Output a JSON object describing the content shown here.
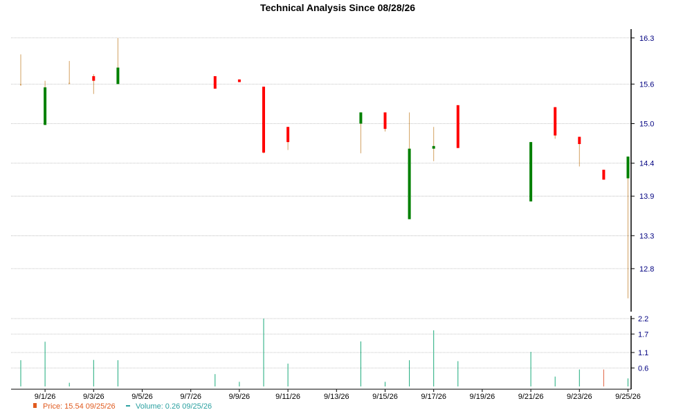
{
  "chart_data": {
    "type": "candlestick",
    "title": "Technical Analysis Since 08/28/26",
    "price_axis": {
      "ylim": [
        12.2,
        16.35
      ],
      "ticks": [
        16.3,
        15.6,
        15.0,
        14.4,
        13.9,
        13.3,
        12.8
      ],
      "tick_labels": [
        "16.3",
        "15.6",
        "15.0",
        "14.4",
        "13.9",
        "13.3",
        "12.8"
      ]
    },
    "volume_axis": {
      "ylim": [
        0.0,
        2.2
      ],
      "ticks": [
        2.2,
        1.7,
        1.1,
        0.6
      ],
      "tick_labels": [
        "2.2",
        "1.7",
        "1.1",
        "0.6"
      ]
    },
    "x_axis": {
      "date_labels": [
        "9/1/26",
        "9/3/26",
        "9/5/26",
        "9/7/26",
        "9/9/26",
        "9/11/26",
        "9/13/26",
        "9/15/26",
        "9/17/26",
        "9/19/26",
        "9/21/26",
        "9/23/26",
        "9/25/26"
      ]
    },
    "candles": [
      {
        "date": "8/31/26",
        "open": 15.6,
        "high": 16.05,
        "low": 15.6,
        "close": 15.6,
        "dir": "flat"
      },
      {
        "date": "9/1/26",
        "open": 14.98,
        "high": 15.65,
        "low": 14.98,
        "close": 15.55,
        "dir": "up"
      },
      {
        "date": "9/2/26",
        "open": 15.62,
        "high": 15.95,
        "low": 15.6,
        "close": 15.62,
        "dir": "flat"
      },
      {
        "date": "9/3/26",
        "open": 15.72,
        "high": 15.75,
        "low": 15.45,
        "close": 15.65,
        "dir": "down"
      },
      {
        "date": "9/4/26",
        "open": 15.6,
        "high": 16.3,
        "low": 15.6,
        "close": 15.85,
        "dir": "up"
      },
      {
        "date": "9/8/26",
        "open": 15.72,
        "high": 15.72,
        "low": 15.53,
        "close": 15.53,
        "dir": "down"
      },
      {
        "date": "9/9/26",
        "open": 15.67,
        "high": 15.67,
        "low": 15.63,
        "close": 15.63,
        "dir": "down"
      },
      {
        "date": "9/10/26",
        "open": 15.56,
        "high": 15.56,
        "low": 14.55,
        "close": 14.56,
        "dir": "down"
      },
      {
        "date": "9/11/26",
        "open": 14.95,
        "high": 14.95,
        "low": 14.6,
        "close": 14.72,
        "dir": "down"
      },
      {
        "date": "9/14/26",
        "open": 15.0,
        "high": 15.17,
        "low": 14.55,
        "close": 15.17,
        "dir": "up"
      },
      {
        "date": "9/15/26",
        "open": 15.17,
        "high": 15.17,
        "low": 14.88,
        "close": 14.92,
        "dir": "down"
      },
      {
        "date": "9/16/26",
        "open": 13.55,
        "high": 15.17,
        "low": 13.55,
        "close": 14.62,
        "dir": "up"
      },
      {
        "date": "9/17/26",
        "open": 14.62,
        "high": 14.95,
        "low": 14.43,
        "close": 14.66,
        "dir": "up"
      },
      {
        "date": "9/18/26",
        "open": 15.28,
        "high": 15.28,
        "low": 14.63,
        "close": 14.63,
        "dir": "down"
      },
      {
        "date": "9/21/26",
        "open": 13.82,
        "high": 14.72,
        "low": 13.82,
        "close": 14.72,
        "dir": "up"
      },
      {
        "date": "9/22/26",
        "open": 15.25,
        "high": 15.25,
        "low": 14.77,
        "close": 14.82,
        "dir": "down"
      },
      {
        "date": "9/23/26",
        "open": 14.8,
        "high": 14.8,
        "low": 14.35,
        "close": 14.69,
        "dir": "down"
      },
      {
        "date": "9/24/26",
        "open": 14.3,
        "high": 14.3,
        "low": 14.15,
        "close": 14.15,
        "dir": "down"
      },
      {
        "date": "9/25/26",
        "open": 14.17,
        "high": 14.5,
        "low": 12.35,
        "close": 14.5,
        "dir": "up"
      }
    ],
    "volume": [
      0.85,
      1.45,
      0.12,
      0.86,
      0.85,
      0.4,
      0.15,
      2.2,
      0.74,
      1.46,
      0.15,
      0.85,
      1.82,
      0.82,
      1.12,
      0.32,
      0.55,
      0.55,
      0.26
    ],
    "colors": {
      "up": "#008000",
      "down": "#ff0000",
      "wick": "#d2a060",
      "volume": "#1aaa7a",
      "volume_last": "#e06040",
      "grid": "#b0b0b0",
      "axis_text": "#000080"
    }
  },
  "legend": {
    "price_label": "Price: 15.54  09/25/26",
    "volume_label": "Volume: 0.26  09/25/26",
    "price_color": "#e05a1e",
    "volume_color": "#2aa0a0"
  }
}
